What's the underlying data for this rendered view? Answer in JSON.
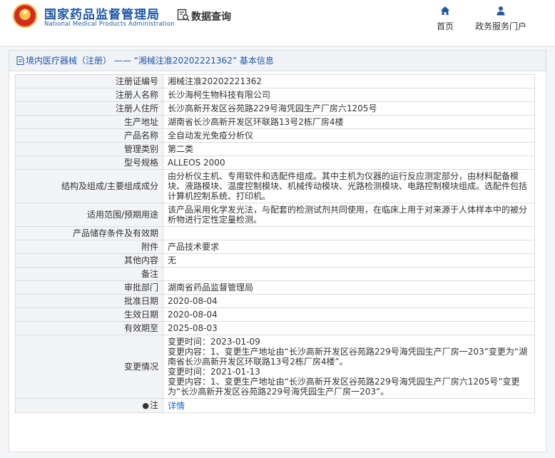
{
  "header": {
    "brand_cn": "国家药品监督管理局",
    "brand_en": "National Medical Products Administration",
    "query_label": "数据查询",
    "nav": [
      {
        "label": "首页",
        "icon": "home-icon"
      },
      {
        "label": "政务服务门户",
        "icon": "user-icon"
      }
    ],
    "accent_color": "#1f58a6"
  },
  "panel": {
    "title": "境内医疗器械（注册） —— “湘械注准20202221362” 基本信息",
    "rows": [
      {
        "label": "注册证编号",
        "value": "湘械注准20202221362"
      },
      {
        "label": "注册人名称",
        "value": "长沙海柯生物科技有限公司"
      },
      {
        "label": "注册人住所",
        "value": "长沙高新开发区谷苑路229号海凭园生产厂房六1205号"
      },
      {
        "label": "生产地址",
        "value": "湖南省长沙高新开发区环联路13号2栋厂房4楼"
      },
      {
        "label": "产品名称",
        "value": "全自动发光免疫分析仪"
      },
      {
        "label": "管理类别",
        "value": "第二类"
      },
      {
        "label": "型号规格",
        "value": "ALLEOS 2000"
      },
      {
        "label": "结构及组成/主要组成成分",
        "value": "由分析仪主机、专用软件和选配件组成。其中主机为仪器的运行反应测定部分，由材料配备模块、液路模块、温度控制模块、机械传动模块、光路检测模块、电路控制模块组成。选配件包括计算机控制系统、打印机。"
      },
      {
        "label": "适用范围/预期用途",
        "value": "该产品采用化学发光法，与配套的检测试剂共同使用，在临床上用于对来源于人体样本中的被分析物进行定性定量检测。"
      },
      {
        "label": "产品储存条件及有效期",
        "value": ""
      },
      {
        "label": "附件",
        "value": "产品技术要求"
      },
      {
        "label": "其他内容",
        "value": "无"
      },
      {
        "label": "备注",
        "value": ""
      },
      {
        "label": "审批部门",
        "value": "湖南省药品监督管理局"
      },
      {
        "label": "批准日期",
        "value": "2020-08-04"
      },
      {
        "label": "生效日期",
        "value": "2020-08-04"
      },
      {
        "label": "有效期至",
        "value": "2025-08-03"
      }
    ],
    "changes": {
      "label": "变更情况",
      "lines": [
        "变更时间：2023-01-09",
        "变更内容：1、变更生产地址由“长沙高新开发区谷苑路229号海凭园生产厂房一203”变更为“湖南省长沙高新开发区环联路13号2栋厂房4楼”。",
        "变更时间：2021-01-13",
        "变更内容：1、变更生产地址由“长沙高新开发区谷苑路229号海凭园生产厂房六1205号”变更为“长沙高新开发区谷苑路229号海凭园生产厂房一203”。"
      ]
    },
    "note": {
      "label": "注",
      "link": "详情"
    }
  }
}
